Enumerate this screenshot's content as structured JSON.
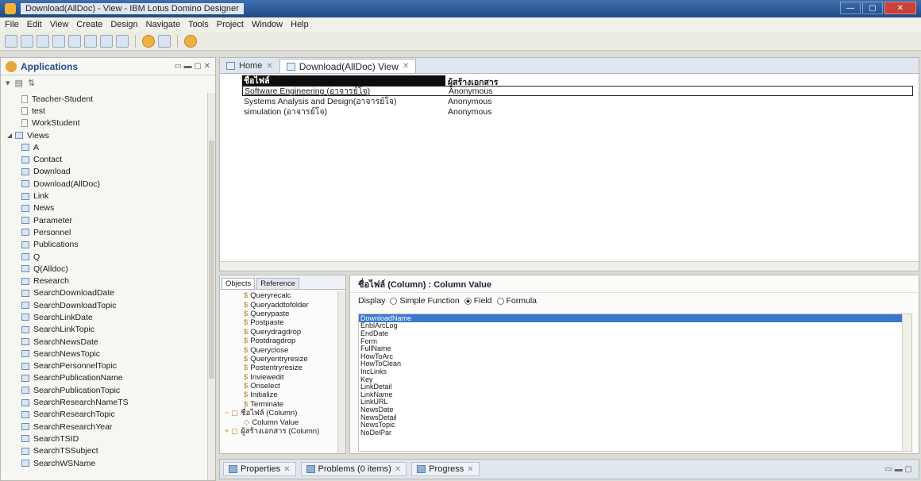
{
  "window": {
    "title": "Download(AllDoc) - View - IBM Lotus Domino Designer"
  },
  "menu": [
    "File",
    "Edit",
    "View",
    "Create",
    "Design",
    "Navigate",
    "Tools",
    "Project",
    "Window",
    "Help"
  ],
  "left_panel": {
    "title": "Applications",
    "tree": [
      {
        "label": "Teacher-Student",
        "type": "doc",
        "indent": 2
      },
      {
        "label": "test",
        "type": "doc",
        "indent": 2
      },
      {
        "label": "WorkStudent",
        "type": "doc",
        "indent": 2
      },
      {
        "label": "Views",
        "type": "folder",
        "indent": 0,
        "twisty": "◢"
      },
      {
        "label": "A",
        "type": "view",
        "indent": 2
      },
      {
        "label": "Contact",
        "type": "view",
        "indent": 2
      },
      {
        "label": "Download",
        "type": "view",
        "indent": 2
      },
      {
        "label": "Download(AllDoc)",
        "type": "view",
        "indent": 2
      },
      {
        "label": "Link",
        "type": "view",
        "indent": 2
      },
      {
        "label": "News",
        "type": "view",
        "indent": 2
      },
      {
        "label": "Parameter",
        "type": "view",
        "indent": 2
      },
      {
        "label": "Personnel",
        "type": "view",
        "indent": 2
      },
      {
        "label": "Publications",
        "type": "view",
        "indent": 2
      },
      {
        "label": "Q",
        "type": "view",
        "indent": 2
      },
      {
        "label": "Q(Alldoc)",
        "type": "view",
        "indent": 2
      },
      {
        "label": "Research",
        "type": "view",
        "indent": 2
      },
      {
        "label": "SearchDownloadDate",
        "type": "view",
        "indent": 2
      },
      {
        "label": "SearchDownloadTopic",
        "type": "view",
        "indent": 2
      },
      {
        "label": "SearchLinkDate",
        "type": "view",
        "indent": 2
      },
      {
        "label": "SearchLinkTopic",
        "type": "view",
        "indent": 2
      },
      {
        "label": "SearchNewsDate",
        "type": "view",
        "indent": 2
      },
      {
        "label": "SearchNewsTopic",
        "type": "view",
        "indent": 2
      },
      {
        "label": "SearchPersonnelTopic",
        "type": "view",
        "indent": 2
      },
      {
        "label": "SearchPublicationName",
        "type": "view",
        "indent": 2
      },
      {
        "label": "SearchPublicationTopic",
        "type": "view",
        "indent": 2
      },
      {
        "label": "SearchResearchNameTS",
        "type": "view",
        "indent": 2
      },
      {
        "label": "SearchResearchTopic",
        "type": "view",
        "indent": 2
      },
      {
        "label": "SearchResearchYear",
        "type": "view",
        "indent": 2
      },
      {
        "label": "SearchTSID",
        "type": "view",
        "indent": 2
      },
      {
        "label": "SearchTSSubject",
        "type": "view",
        "indent": 2
      },
      {
        "label": "SearchWSName",
        "type": "view",
        "indent": 2
      }
    ]
  },
  "editor": {
    "tabs": [
      {
        "label": "Home",
        "active": false
      },
      {
        "label": "Download(AllDoc)  View",
        "active": true
      }
    ],
    "columns": [
      "ชื่อไฟล์",
      "ผู้สร้างเอกสาร"
    ],
    "rows": [
      [
        "Software Engineering (อาจารย์โจ)",
        "Anonymous"
      ],
      [
        "Systems Analysis and Design(อาจารย์โจ)",
        "Anonymous"
      ],
      [
        "simulation (อาจารย์โจ)",
        "Anonymous"
      ]
    ]
  },
  "objects_panel": {
    "tabs": [
      "Objects",
      "Reference"
    ],
    "items": [
      {
        "label": "Queryrecalc",
        "lead": "$",
        "indent": 30
      },
      {
        "label": "Queryaddtofolder",
        "lead": "$",
        "indent": 30
      },
      {
        "label": "Querypaste",
        "lead": "$",
        "indent": 30
      },
      {
        "label": "Postpaste",
        "lead": "$",
        "indent": 30
      },
      {
        "label": "Querydragdrop",
        "lead": "$",
        "indent": 30
      },
      {
        "label": "Postdragdrop",
        "lead": "$",
        "indent": 30
      },
      {
        "label": "Queryclose",
        "lead": "$",
        "indent": 30
      },
      {
        "label": "Queryentryresize",
        "lead": "$",
        "indent": 30
      },
      {
        "label": "Postentryresize",
        "lead": "$",
        "indent": 30
      },
      {
        "label": "Inviewedit",
        "lead": "$",
        "indent": 30
      },
      {
        "label": "Onselect",
        "lead": "$",
        "indent": 30
      },
      {
        "label": "Initialize",
        "lead": "$",
        "indent": 30
      },
      {
        "label": "Terminate",
        "lead": "$",
        "indent": 30
      },
      {
        "label": "ชื่อไฟล์ (Column)",
        "lead": "− ▢",
        "indent": 6
      },
      {
        "label": "Column Value",
        "lead": "◇",
        "indent": 30
      },
      {
        "label": "ผู้สร้างเอกสาร (Column)",
        "lead": "+ ▢",
        "indent": 6
      }
    ]
  },
  "column_panel": {
    "title": "ชื่อไฟล์ (Column) : Column Value",
    "display_label": "Display",
    "options": [
      {
        "label": "Simple Function",
        "selected": false
      },
      {
        "label": "Field",
        "selected": true
      },
      {
        "label": "Formula",
        "selected": false
      }
    ],
    "fields": [
      "DownloadName",
      "EnblArcLog",
      "EndDate",
      "Form",
      "FullName",
      "HowToArc",
      "HowToClean",
      "IncLinks",
      "Key",
      "LinkDetail",
      "LinkName",
      "LinkURL",
      "NewsDate",
      "NewsDetail",
      "NewsTopic",
      "NoDelPar"
    ],
    "selected_field": "DownloadName"
  },
  "bottom_tabs": [
    {
      "label": "Properties"
    },
    {
      "label": "Problems (0 items)"
    },
    {
      "label": "Progress"
    }
  ]
}
